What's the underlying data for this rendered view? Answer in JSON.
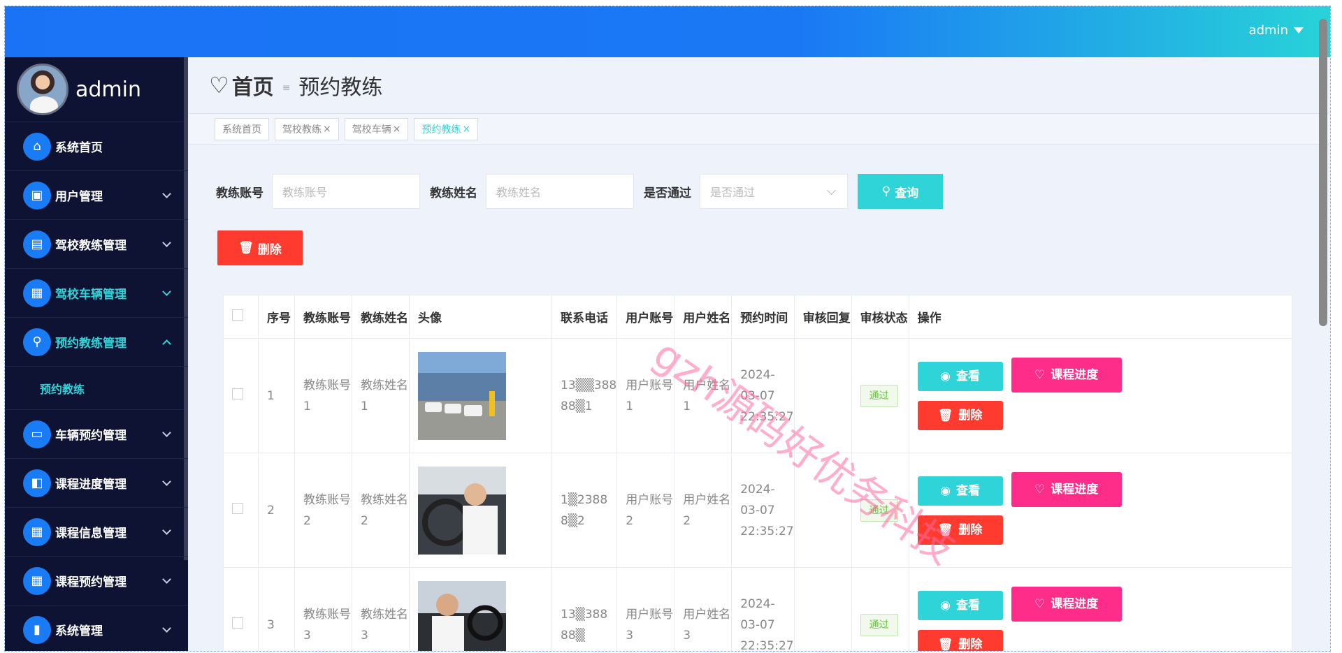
{
  "header": {
    "user": "admin"
  },
  "sidebar": {
    "profile_name": "admin",
    "items": [
      {
        "label": "系统首页",
        "icon": "home-icon"
      },
      {
        "label": "用户管理",
        "icon": "briefcase-icon"
      },
      {
        "label": "驾校教练管理",
        "icon": "clipboard-icon"
      },
      {
        "label": "驾校车辆管理",
        "icon": "grid-icon"
      },
      {
        "label": "预约教练管理",
        "icon": "user-stamp-icon",
        "active": true
      },
      {
        "label": "车辆预约管理",
        "icon": "monitor-icon"
      },
      {
        "label": "课程进度管理",
        "icon": "wallet-icon"
      },
      {
        "label": "课程信息管理",
        "icon": "grid-icon"
      },
      {
        "label": "课程预约管理",
        "icon": "grid-icon"
      },
      {
        "label": "系统管理",
        "icon": "book-icon"
      }
    ],
    "submenu": {
      "label": "预约教练"
    }
  },
  "breadcrumb": {
    "home": "首页",
    "current": "预约教练"
  },
  "tabs": [
    "系统首页",
    "驾校教练",
    "驾校车辆",
    "预约教练"
  ],
  "search": {
    "label1": "教练账号",
    "placeholder1": "教练账号",
    "label2": "教练姓名",
    "placeholder2": "教练姓名",
    "label3": "是否通过",
    "placeholder3": "是否通过",
    "query": "查询"
  },
  "delete_label": "删除",
  "table": {
    "headers": [
      "序号",
      "教练账号",
      "教练姓名",
      "头像",
      "联系电话",
      "用户账号",
      "用户姓名",
      "预约时间",
      "审核回复",
      "审核状态",
      "操作"
    ],
    "rows": [
      {
        "no": "1",
        "account": "教练账号1",
        "name": "教练姓名1",
        "phone": "13▒▒388 88▒1",
        "user_account": "用户账号1",
        "user_name": "用户姓名1",
        "time": "2024-03-07 22:35:27",
        "reply": "",
        "status": "通过"
      },
      {
        "no": "2",
        "account": "教练账号2",
        "name": "教练姓名2",
        "phone": "1▒2388 8▒2",
        "user_account": "用户账号2",
        "user_name": "用户姓名2",
        "time": "2024-03-07 22:35:27",
        "reply": "",
        "status": "通过"
      },
      {
        "no": "3",
        "account": "教练账号3",
        "name": "教练姓名3",
        "phone": "13▒388 88▒",
        "user_account": "用户账号3",
        "user_name": "用户姓名3",
        "time": "2024-03-07 22:35:27",
        "reply": "",
        "status": "通过"
      }
    ],
    "actions": {
      "view": "查看",
      "progress": "课程进度",
      "delete": "删除"
    }
  },
  "watermark": "gzh源码好优务科技",
  "colors": {
    "accent": "#2ed4d8",
    "primary": "#1a73f5",
    "danger": "#ff3b30",
    "pink": "#ff2d8a",
    "sidebar": "#0e1333"
  }
}
